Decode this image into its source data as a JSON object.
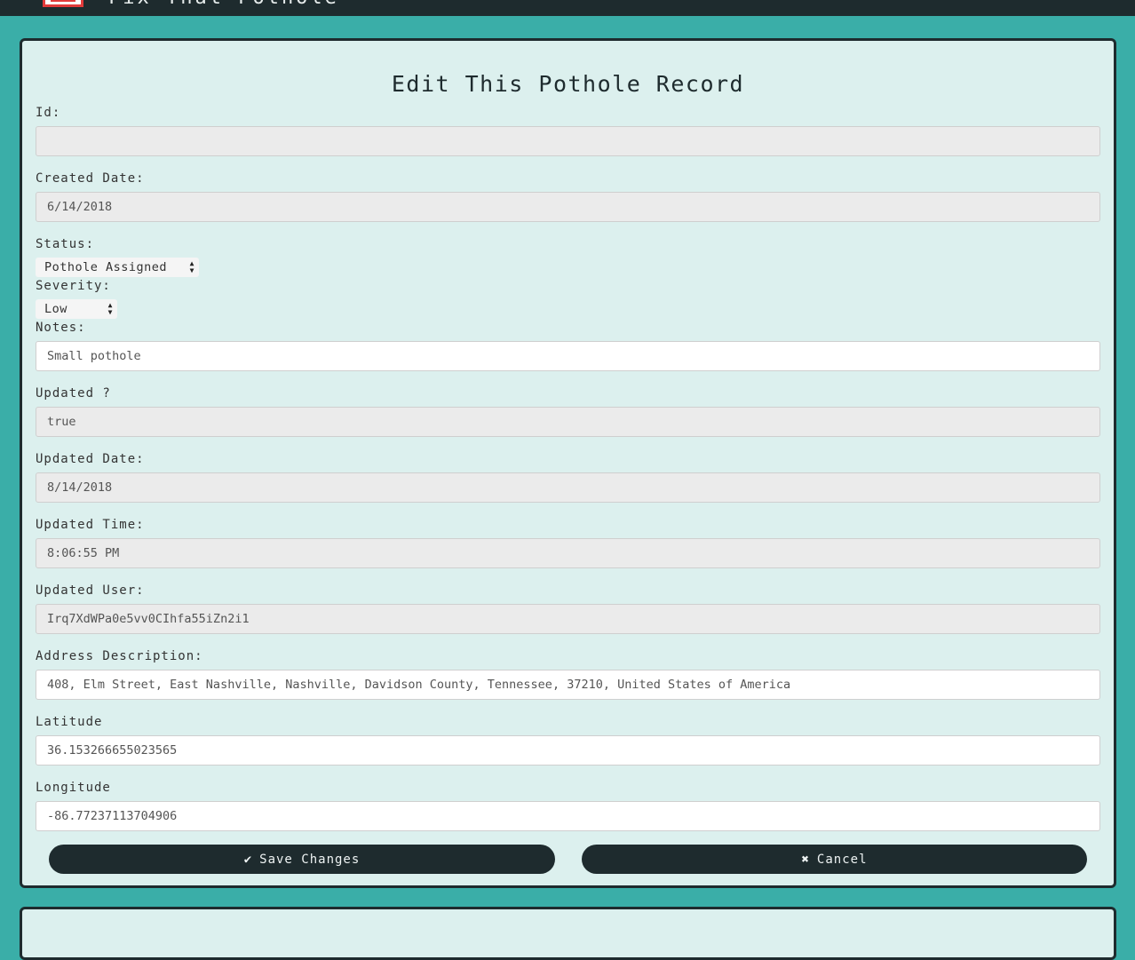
{
  "header": {
    "brand": "Fix That Pothole"
  },
  "form": {
    "title": "Edit This Pothole Record",
    "fields": {
      "id": {
        "label": "Id:",
        "value": ""
      },
      "created_date": {
        "label": "Created Date:",
        "value": "6/14/2018"
      },
      "status": {
        "label": "Status:",
        "value": "Pothole Assigned"
      },
      "severity": {
        "label": "Severity:",
        "value": "Low"
      },
      "notes": {
        "label": "Notes:",
        "value": "Small pothole"
      },
      "updated": {
        "label": "Updated ?",
        "value": "true"
      },
      "updated_date": {
        "label": "Updated Date:",
        "value": "8/14/2018"
      },
      "updated_time": {
        "label": "Updated Time:",
        "value": "8:06:55 PM"
      },
      "updated_user": {
        "label": "Updated User:",
        "value": "Irq7XdWPa0e5vv0CIhfa55iZn2i1"
      },
      "address": {
        "label": "Address Description:",
        "value": "408, Elm Street, East Nashville, Nashville, Davidson County, Tennessee, 37210, United States of America"
      },
      "latitude": {
        "label": "Latitude",
        "value": "36.153266655023565"
      },
      "longitude": {
        "label": "Longitude",
        "value": "-86.77237113704906"
      }
    },
    "buttons": {
      "save_label": "Save Changes",
      "save_icon": "check-icon",
      "cancel_label": "Cancel",
      "cancel_icon": "times-icon"
    }
  },
  "colors": {
    "page_background": "#3aaea8",
    "card_background": "#dcf0ee",
    "dark": "#1e2b2e",
    "logo_accent": "#e23b3b"
  }
}
